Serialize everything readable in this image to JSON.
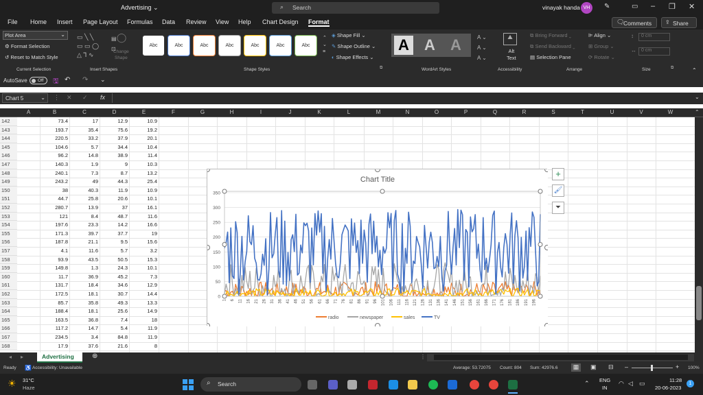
{
  "titlebar": {
    "file_name": "Advertising",
    "search_placeholder": "Search",
    "user_name": "vinayak handa",
    "user_initials": "VH"
  },
  "menu": {
    "tabs": [
      "File",
      "Home",
      "Insert",
      "Page Layout",
      "Formulas",
      "Data",
      "Review",
      "View",
      "Help",
      "Chart Design",
      "Format"
    ],
    "active_tab": "Format",
    "comments": "Comments",
    "share": "Share"
  },
  "ribbon": {
    "selection_dropdown": "Plot Area",
    "format_selection": "Format Selection",
    "reset_style": "Reset to Match Style",
    "shape_style_label": "Abc",
    "shape_fill": "Shape Fill",
    "shape_outline": "Shape Outline",
    "shape_effects": "Shape Effects",
    "wordart_letter": "A",
    "alt_text_line1": "Alt",
    "alt_text_line2": "Text",
    "bring_forward": "Bring Forward",
    "send_backward": "Send Backward",
    "selection_pane": "Selection Pane",
    "align": "Align",
    "group": "Group",
    "rotate": "Rotate",
    "change_shape_line1": "Change",
    "change_shape_line2": "Shape",
    "height_value": "0 cm",
    "width_value": "0 cm",
    "groups": {
      "current_selection": "Current Selection",
      "insert_shapes": "Insert Shapes",
      "shape_styles": "Shape Styles",
      "wordart_styles": "WordArt Styles",
      "accessibility": "Accessibility",
      "arrange": "Arrange",
      "size": "Size"
    }
  },
  "qat": {
    "autosave_label": "AutoSave",
    "autosave_state": "Off"
  },
  "formula_bar": {
    "name_box": "Chart 5",
    "fx": "fx",
    "formula": ""
  },
  "columns": [
    "A",
    "B",
    "C",
    "D",
    "E",
    "F",
    "G",
    "H",
    "I",
    "J",
    "K",
    "L",
    "M",
    "N",
    "O",
    "P",
    "Q",
    "R",
    "S",
    "T",
    "U",
    "V",
    "W"
  ],
  "rows": [
    {
      "n": "142",
      "b": "73.4",
      "c": "17",
      "d": "12.9",
      "e": "10.9"
    },
    {
      "n": "143",
      "b": "193.7",
      "c": "35.4",
      "d": "75.6",
      "e": "19.2"
    },
    {
      "n": "144",
      "b": "220.5",
      "c": "33.2",
      "d": "37.9",
      "e": "20.1"
    },
    {
      "n": "145",
      "b": "104.6",
      "c": "5.7",
      "d": "34.4",
      "e": "10.4"
    },
    {
      "n": "146",
      "b": "96.2",
      "c": "14.8",
      "d": "38.9",
      "e": "11.4"
    },
    {
      "n": "147",
      "b": "140.3",
      "c": "1.9",
      "d": "9",
      "e": "10.3"
    },
    {
      "n": "148",
      "b": "240.1",
      "c": "7.3",
      "d": "8.7",
      "e": "13.2"
    },
    {
      "n": "149",
      "b": "243.2",
      "c": "49",
      "d": "44.3",
      "e": "25.4"
    },
    {
      "n": "150",
      "b": "38",
      "c": "40.3",
      "d": "11.9",
      "e": "10.9"
    },
    {
      "n": "151",
      "b": "44.7",
      "c": "25.8",
      "d": "20.6",
      "e": "10.1"
    },
    {
      "n": "152",
      "b": "280.7",
      "c": "13.9",
      "d": "37",
      "e": "16.1"
    },
    {
      "n": "153",
      "b": "121",
      "c": "8.4",
      "d": "48.7",
      "e": "11.6"
    },
    {
      "n": "154",
      "b": "197.6",
      "c": "23.3",
      "d": "14.2",
      "e": "16.6"
    },
    {
      "n": "155",
      "b": "171.3",
      "c": "39.7",
      "d": "37.7",
      "e": "19"
    },
    {
      "n": "156",
      "b": "187.8",
      "c": "21.1",
      "d": "9.5",
      "e": "15.6"
    },
    {
      "n": "157",
      "b": "4.1",
      "c": "11.6",
      "d": "5.7",
      "e": "3.2"
    },
    {
      "n": "158",
      "b": "93.9",
      "c": "43.5",
      "d": "50.5",
      "e": "15.3"
    },
    {
      "n": "159",
      "b": "149.8",
      "c": "1.3",
      "d": "24.3",
      "e": "10.1"
    },
    {
      "n": "160",
      "b": "11.7",
      "c": "36.9",
      "d": "45.2",
      "e": "7.3"
    },
    {
      "n": "161",
      "b": "131.7",
      "c": "18.4",
      "d": "34.6",
      "e": "12.9"
    },
    {
      "n": "162",
      "b": "172.5",
      "c": "18.1",
      "d": "30.7",
      "e": "14.4"
    },
    {
      "n": "163",
      "b": "85.7",
      "c": "35.8",
      "d": "49.3",
      "e": "13.3"
    },
    {
      "n": "164",
      "b": "188.4",
      "c": "18.1",
      "d": "25.6",
      "e": "14.9"
    },
    {
      "n": "165",
      "b": "163.5",
      "c": "36.8",
      "d": "7.4",
      "e": "18"
    },
    {
      "n": "166",
      "b": "117.2",
      "c": "14.7",
      "d": "5.4",
      "e": "11.9"
    },
    {
      "n": "167",
      "b": "234.5",
      "c": "3.4",
      "d": "84.8",
      "e": "11.9"
    },
    {
      "n": "168",
      "b": "17.9",
      "c": "37.6",
      "d": "21.6",
      "e": "8"
    }
  ],
  "chart_data": {
    "type": "line",
    "title": "Chart Title",
    "ylim": [
      0,
      350
    ],
    "yticks": [
      "0",
      "50",
      "100",
      "150",
      "200",
      "250",
      "300",
      "350"
    ],
    "xticks": [
      "1",
      "6",
      "11",
      "16",
      "21",
      "26",
      "31",
      "36",
      "41",
      "46",
      "51",
      "56",
      "61",
      "66",
      "71",
      "76",
      "81",
      "86",
      "91",
      "96",
      "101",
      "106",
      "111",
      "116",
      "121",
      "126",
      "131",
      "136",
      "141",
      "146",
      "151",
      "156",
      "161",
      "166",
      "171",
      "176",
      "181",
      "186",
      "191",
      "196"
    ],
    "n_points": 200,
    "series": [
      {
        "name": "radio",
        "color": "#ed7d31",
        "range": [
          0,
          50
        ]
      },
      {
        "name": "newspaper",
        "color": "#a5a5a5",
        "range": [
          0,
          114
        ]
      },
      {
        "name": "sales",
        "color": "#ffc000",
        "range": [
          1,
          27
        ]
      },
      {
        "name": "TV",
        "color": "#4472c4",
        "range": [
          1,
          296
        ]
      }
    ]
  },
  "sheet_tab": "Advertising",
  "status": {
    "ready": "Ready",
    "accessibility": "Accessibility: Unavailable",
    "average": "Average: 53.72075",
    "count": "Count: 804",
    "sum": "Sum: 42976.6",
    "zoom": "100%"
  },
  "taskbar": {
    "temp": "31°C",
    "weather": "Haze",
    "search": "Search",
    "lang1": "ENG",
    "lang2": "IN",
    "time": "11:28",
    "date": "20-06-2023",
    "badge": "1"
  }
}
